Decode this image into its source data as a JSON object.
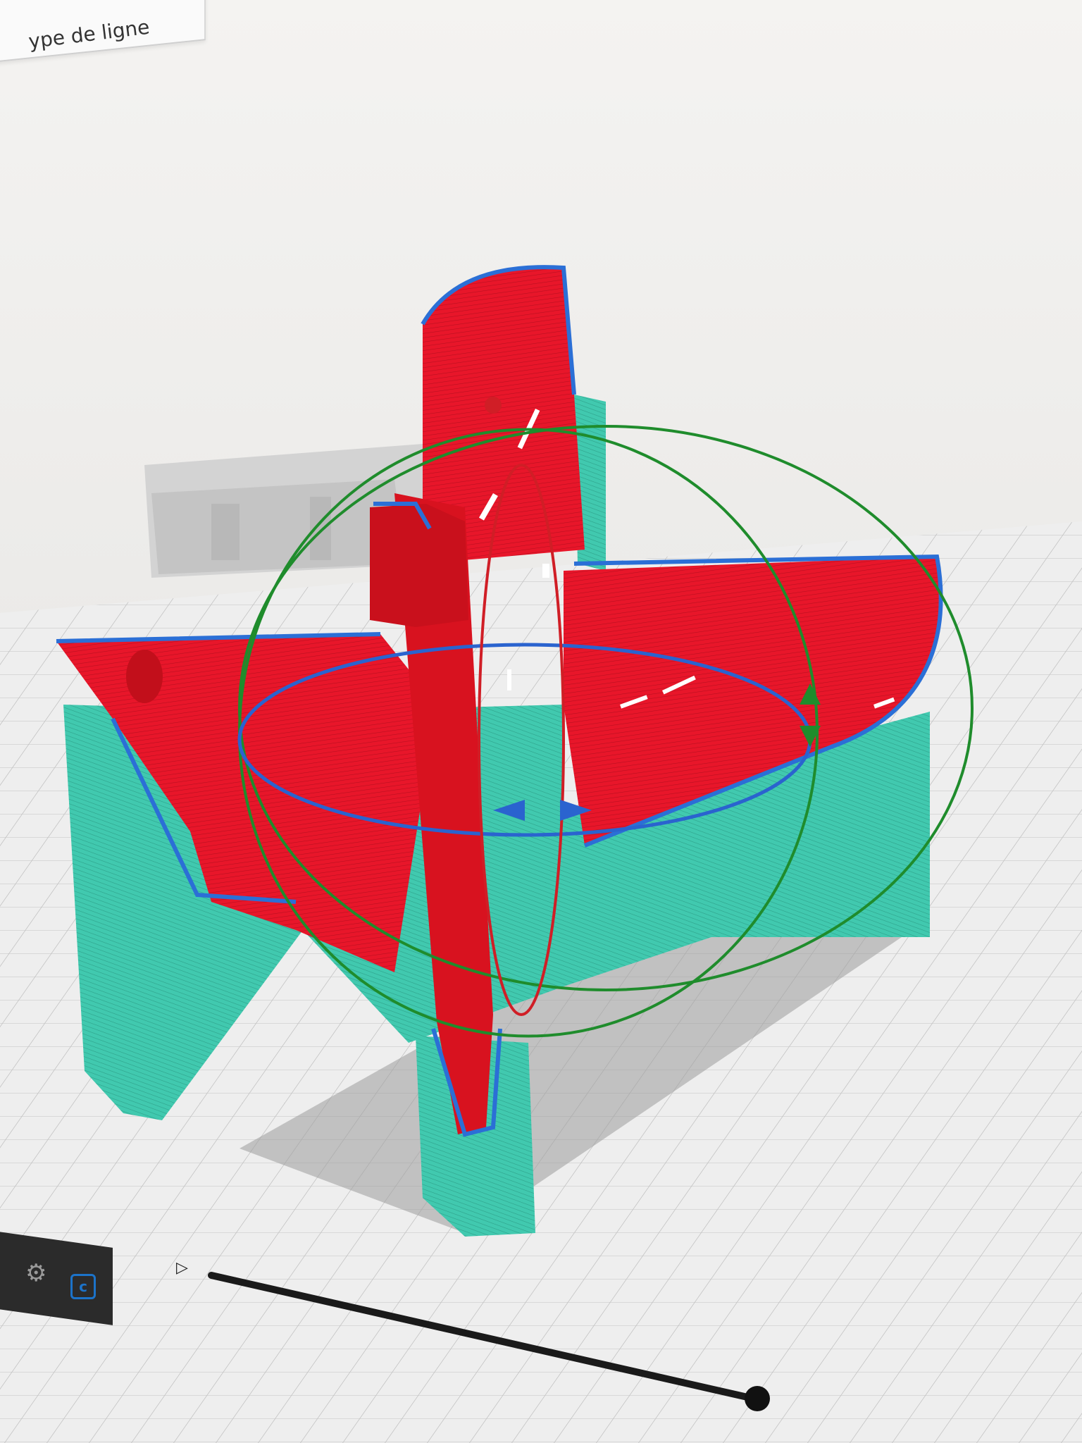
{
  "legend": {
    "title": "ype de ligne"
  },
  "layer_slider": {
    "position_fraction": 1.0
  },
  "colors": {
    "background": "#ecebe9",
    "infill_red": "#e8162a",
    "support_cyan": "#3fc7ad",
    "outline_blue": "#2b6fd6",
    "gizmo_green": "#1f8c2c",
    "gizmo_red": "#d01e26",
    "gizmo_blue": "#2a63cf",
    "build_plate_grid": "#c9c9c9"
  },
  "icons": {
    "settings": "gear-icon",
    "app": "cura-icon",
    "play": "play-icon"
  }
}
